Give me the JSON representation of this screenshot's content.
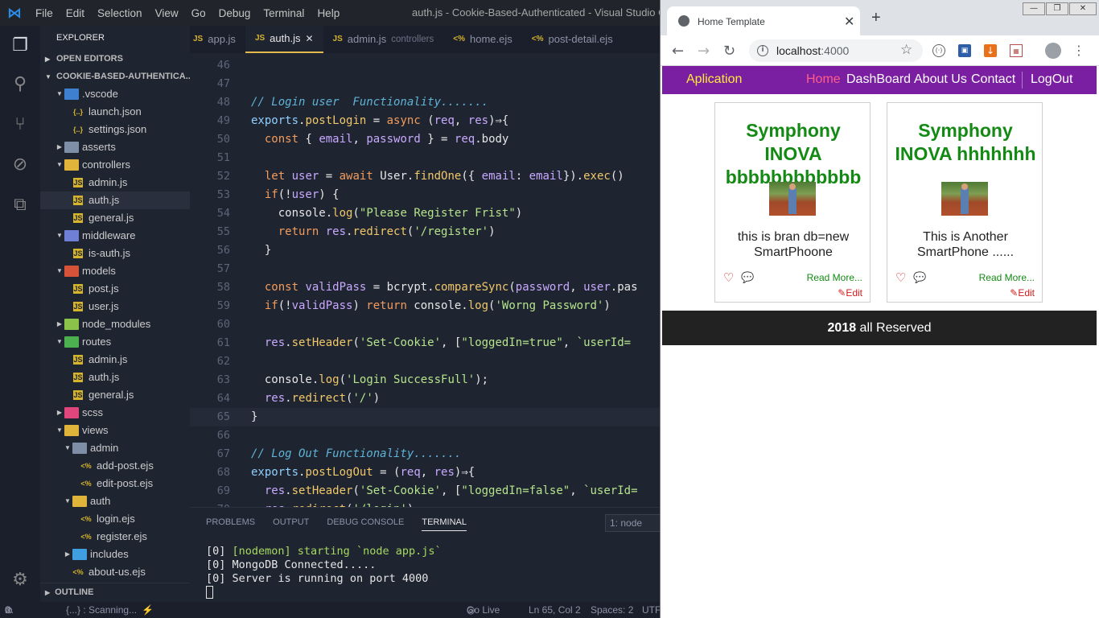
{
  "vscode": {
    "window_title": "auth.js - Cookie-Based-Authenticated - Visual Studio Code",
    "menu": [
      "File",
      "Edit",
      "Selection",
      "View",
      "Go",
      "Debug",
      "Terminal",
      "Help"
    ],
    "explorer": {
      "title": "EXPLORER",
      "open_editors": "OPEN EDITORS",
      "project": "COOKIE-BASED-AUTHENTICA...",
      "outline": "OUTLINE",
      "items": [
        ".vscode",
        "launch.json",
        "settings.json",
        "asserts",
        "controllers",
        "admin.js",
        "auth.js",
        "general.js",
        "middleware",
        "is-auth.js",
        "models",
        "post.js",
        "user.js",
        "node_modules",
        "routes",
        "admin.js",
        "auth.js",
        "general.js",
        "scss",
        "views",
        "admin",
        "add-post.ejs",
        "edit-post.ejs",
        "auth",
        "login.ejs",
        "register.ejs",
        "includes",
        "about-us.ejs"
      ]
    },
    "tabs": [
      {
        "label": "app.js",
        "desc": ""
      },
      {
        "label": "auth.js",
        "desc": ""
      },
      {
        "label": "admin.js",
        "desc": "controllers"
      },
      {
        "label": "home.ejs",
        "desc": ""
      },
      {
        "label": "post-detail.ejs",
        "desc": ""
      }
    ],
    "code_lines": [
      {
        "n": "46",
        "t": ""
      },
      {
        "n": "47",
        "t": ""
      },
      {
        "n": "48",
        "t": "// Login user  Functionality......."
      },
      {
        "n": "49",
        "t": "exports.postLogin = async (req, res)⇒{"
      },
      {
        "n": "50",
        "t": "  const { email, password } = req.body"
      },
      {
        "n": "51",
        "t": ""
      },
      {
        "n": "52",
        "t": "  let user = await User.findOne({ email: email}).exec()"
      },
      {
        "n": "53",
        "t": "  if(!user) {"
      },
      {
        "n": "54",
        "t": "    console.log(\"Please Register Frist\")"
      },
      {
        "n": "55",
        "t": "    return res.redirect('/register')"
      },
      {
        "n": "56",
        "t": "  }"
      },
      {
        "n": "57",
        "t": ""
      },
      {
        "n": "58",
        "t": "  const validPass = bcrypt.compareSync(password, user.pas"
      },
      {
        "n": "59",
        "t": "  if(!validPass) return console.log('Worng Password')"
      },
      {
        "n": "60",
        "t": ""
      },
      {
        "n": "61",
        "t": "  res.setHeader('Set-Cookie', [\"loggedIn=true\", `userId="
      },
      {
        "n": "62",
        "t": ""
      },
      {
        "n": "63",
        "t": "  console.log('Login SuccessFull');"
      },
      {
        "n": "64",
        "t": "  res.redirect('/')"
      },
      {
        "n": "65",
        "t": "}"
      },
      {
        "n": "66",
        "t": ""
      },
      {
        "n": "67",
        "t": "// Log Out Functionality......."
      },
      {
        "n": "68",
        "t": "exports.postLogOut = (req, res)⇒{"
      },
      {
        "n": "69",
        "t": "  res.setHeader('Set-Cookie', [\"loggedIn=false\", `userId="
      },
      {
        "n": "70",
        "t": "  res.redirect('/login')"
      }
    ],
    "panel": {
      "tabs": [
        "PROBLEMS",
        "OUTPUT",
        "DEBUG CONSOLE",
        "TERMINAL"
      ],
      "selector": "1: node",
      "terminal": [
        {
          "p": "[0] ",
          "t": "[nodemon] starting `node app.js`"
        },
        {
          "p": "[0] ",
          "t": "MongoDB Connected....."
        },
        {
          "p": "[0] ",
          "t": "Server is running on port 4000"
        }
      ]
    },
    "status": {
      "errors": "0",
      "warnings": "0",
      "scanning": "{...} : Scanning...",
      "golive": "Go Live",
      "position": "Ln 65, Col 2",
      "spaces": "Spaces: 2",
      "encoding": "UTF"
    }
  },
  "browser": {
    "tab_title": "Home Template",
    "url_host": "localhost",
    "url_port": ":4000",
    "nav": {
      "brand": "Aplication",
      "links": [
        "Home",
        "DashBoard",
        "About Us",
        "Contact",
        "LogOut"
      ]
    },
    "cards": [
      {
        "title": "Symphony INOVA bbbbbbbbbbbb",
        "desc": "this is bran db=new SmartPhoone",
        "read_more": "Read More...",
        "edit": "Edit"
      },
      {
        "title": "Symphony INOVA hhhhhhh",
        "desc": "This is Another SmartPhone ......",
        "read_more": "Read More...",
        "edit": "Edit"
      }
    ],
    "footer": {
      "year": "2018",
      "text": " all Reserved"
    }
  }
}
